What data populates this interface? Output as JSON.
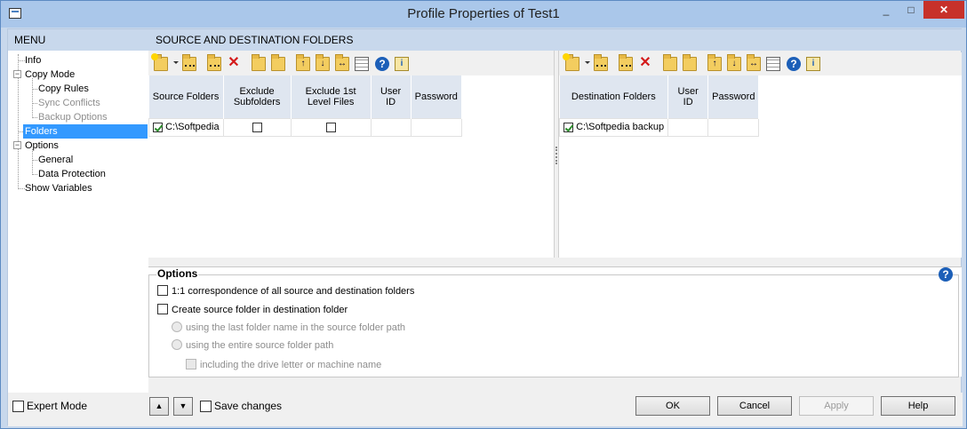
{
  "window": {
    "title": "Profile Properties of Test1",
    "minimize": "_",
    "maximize": "□",
    "close": "✕"
  },
  "menu": {
    "header": "MENU",
    "items": [
      {
        "label": "Info",
        "state": "normal"
      },
      {
        "label": "Copy Mode",
        "state": "normal"
      },
      {
        "label": "Copy Rules",
        "state": "normal"
      },
      {
        "label": "Sync Conflicts",
        "state": "disabled"
      },
      {
        "label": "Backup Options",
        "state": "disabled"
      },
      {
        "label": "Folders",
        "state": "selected"
      },
      {
        "label": "Options",
        "state": "normal"
      },
      {
        "label": "General",
        "state": "normal"
      },
      {
        "label": "Data Protection",
        "state": "normal"
      },
      {
        "label": "Show Variables",
        "state": "normal"
      }
    ]
  },
  "section": {
    "title": "SOURCE AND DESTINATION FOLDERS"
  },
  "toolbar_icons": [
    "new-folder-icon",
    "dropdown-arrow-icon",
    "new-folder-star-icon",
    "browse-folder-icon",
    "delete-icon",
    "find-folder-icon",
    "search-folder-icon",
    "move-up-icon",
    "move-down-icon",
    "swap-icon",
    "columns-icon",
    "help-icon",
    "info-icon"
  ],
  "source": {
    "headers": [
      "Source Folders",
      "Exclude Subfolders",
      "Exclude 1st Level Files",
      "User ID",
      "Password"
    ],
    "rows": [
      {
        "checked": true,
        "folder": "C:\\Softpedia",
        "exclude_subfolders": false,
        "exclude_first_level": false,
        "user_id": "",
        "password": ""
      }
    ]
  },
  "destination": {
    "headers": [
      "Destination Folders",
      "User ID",
      "Password"
    ],
    "rows": [
      {
        "checked": true,
        "folder": "C:\\Softpedia backup",
        "user_id": "",
        "password": ""
      }
    ]
  },
  "options": {
    "title": "Options",
    "correspondence": "1:1 correspondence of all source and destination folders",
    "create_source": "Create source folder in destination folder",
    "radio_last": "using the last folder name in the source folder path",
    "radio_entire": "using the entire source folder path",
    "include_drive": "including the drive letter or machine name"
  },
  "bottom": {
    "expert_mode": "Expert Mode",
    "up": "▲",
    "down": "▼",
    "save_changes": "Save changes",
    "ok": "OK",
    "cancel": "Cancel",
    "apply": "Apply",
    "help": "Help"
  }
}
